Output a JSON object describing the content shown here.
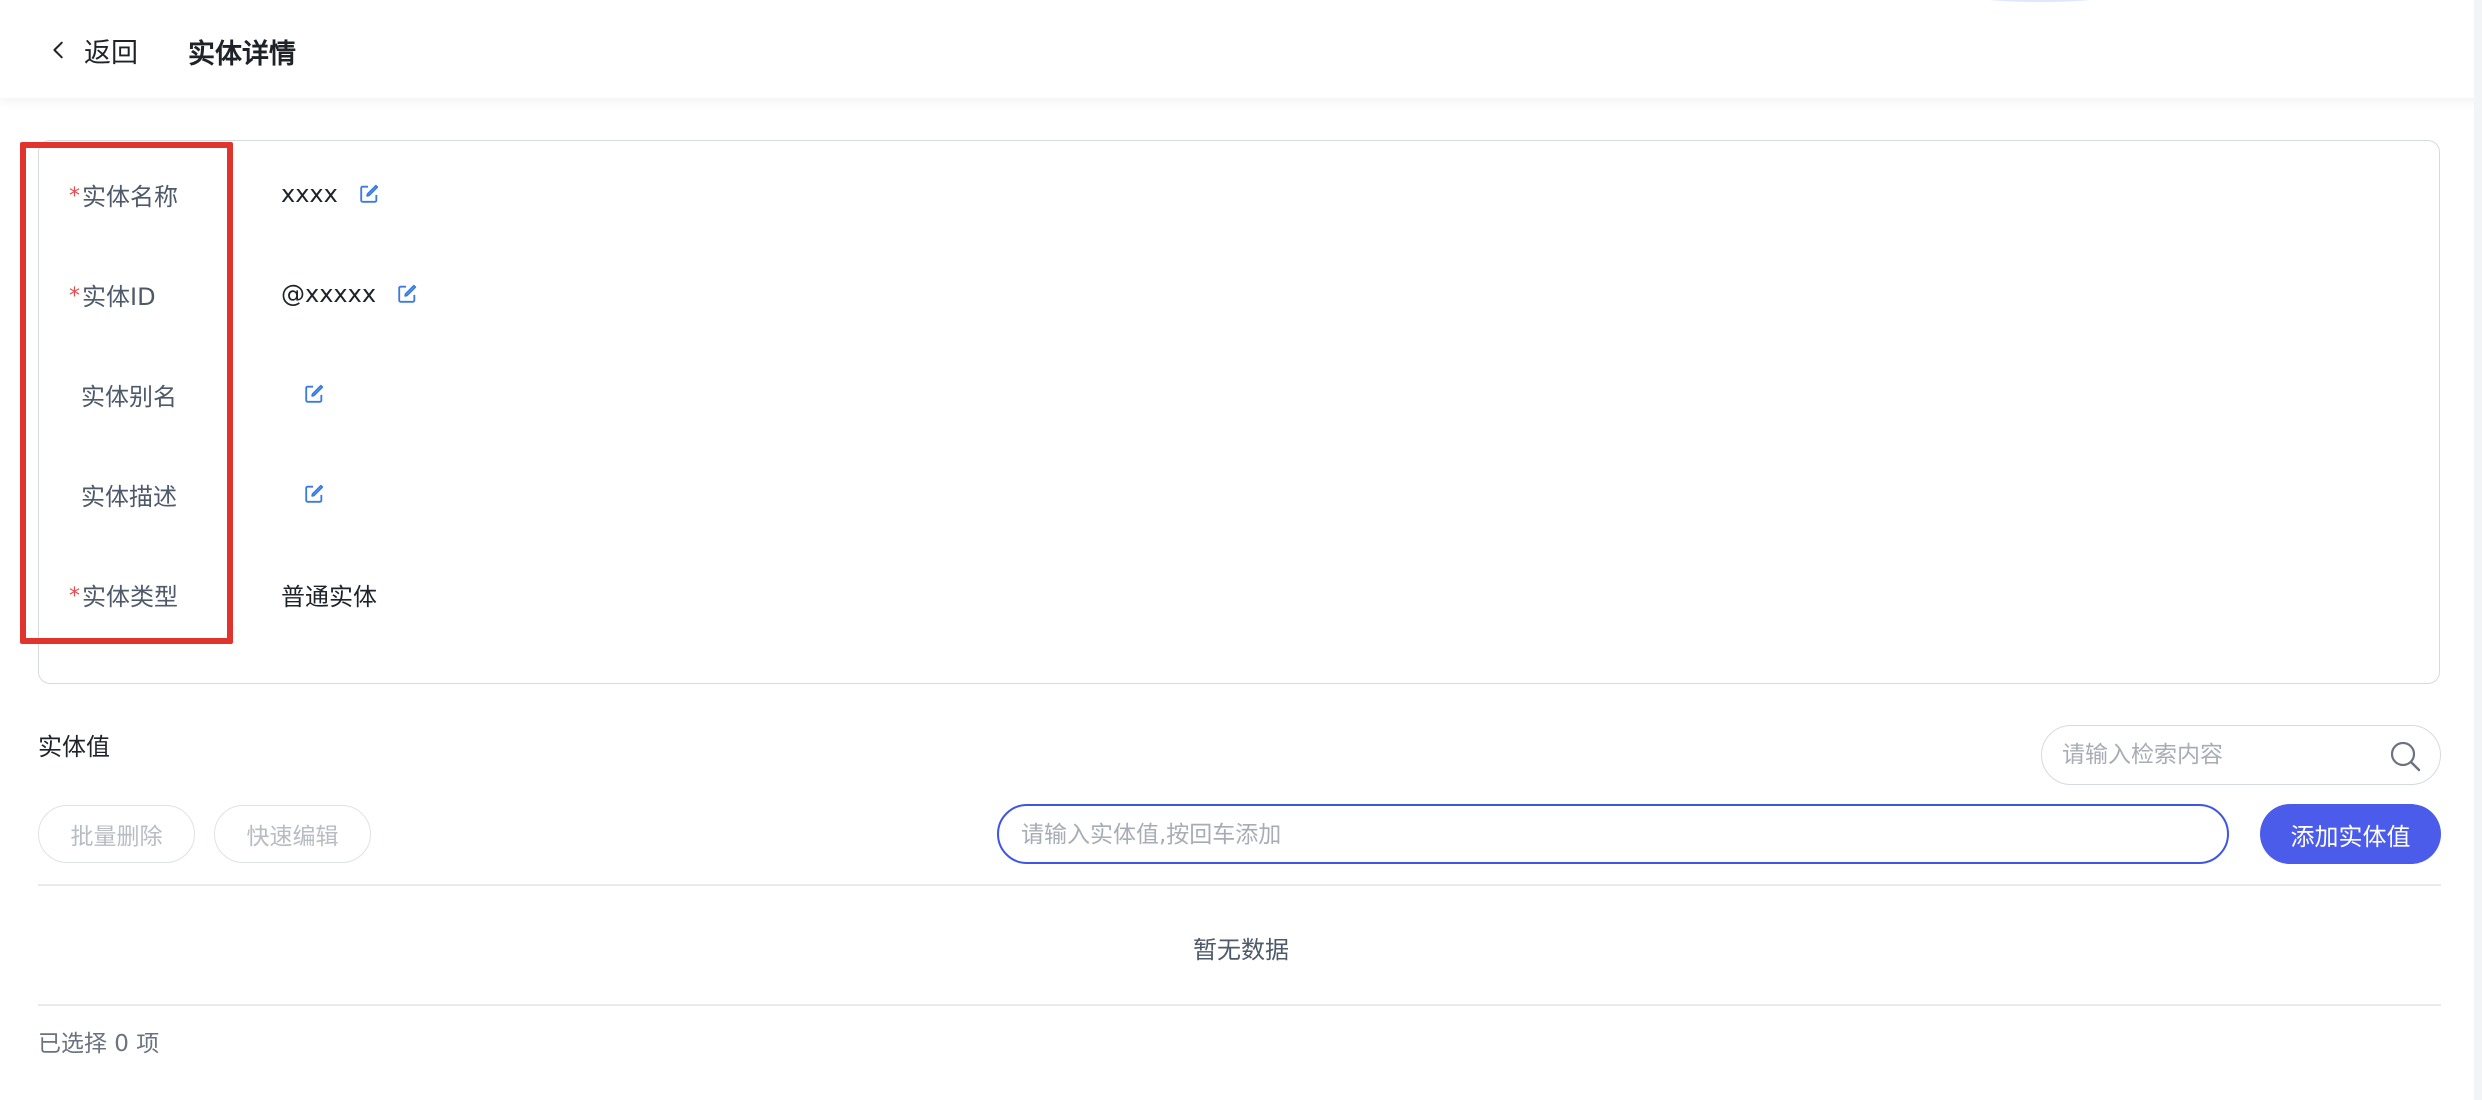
{
  "header": {
    "back_label": "返回",
    "title": "实体详情"
  },
  "entity": {
    "fields": [
      {
        "label": "实体名称",
        "required": true,
        "value": "xxxx",
        "editable": true
      },
      {
        "label": "实体ID",
        "required": true,
        "value": "@xxxxx",
        "editable": true
      },
      {
        "label": "实体别名",
        "required": false,
        "value": "",
        "editable": true
      },
      {
        "label": "实体描述",
        "required": false,
        "value": "",
        "editable": true
      },
      {
        "label": "实体类型",
        "required": true,
        "value": "普通实体",
        "editable": false
      }
    ],
    "required_mark": "*"
  },
  "values_section": {
    "title": "实体值",
    "search_placeholder": "请输入检索内容",
    "batch_delete_label": "批量删除",
    "quick_edit_label": "快速编辑",
    "input_placeholder": "请输入实体值,按回车添加",
    "add_button_label": "添加实体值",
    "empty_text": "暂无数据",
    "selected_text": "已选择 0 项"
  },
  "colors": {
    "accent": "#4b5bea",
    "required": "#e34d4d",
    "highlight_box": "#e0342d",
    "edit_icon": "#3b7be0"
  },
  "icons": {
    "back": "chevron-left-icon",
    "edit": "edit-icon",
    "search": "search-icon"
  }
}
